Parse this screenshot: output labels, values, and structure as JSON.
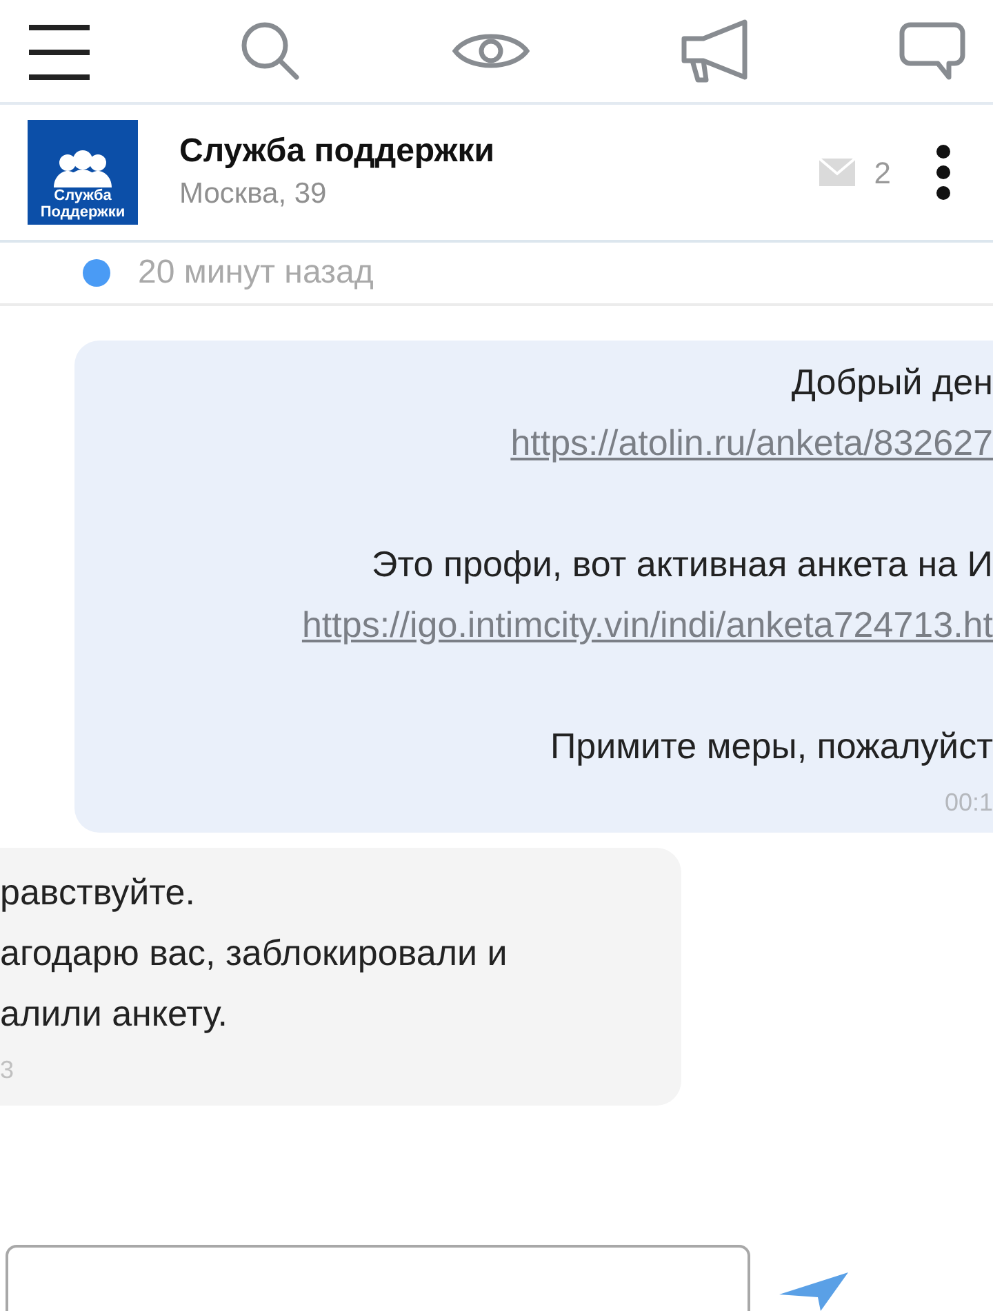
{
  "header": {
    "title": "Служба поддержки",
    "subtitle": "Москва, 39",
    "logo_text": [
      "Служба",
      "Поддержки"
    ],
    "message_count": "2"
  },
  "status": {
    "online": true,
    "last_seen": "20 минут назад"
  },
  "messages": [
    {
      "kind": "outgoing",
      "lines": [
        {
          "kind": "text",
          "text": "Добрый ден"
        },
        {
          "kind": "link",
          "text": "https://atolin.ru/anketa/832627"
        },
        {
          "kind": "blank"
        },
        {
          "kind": "text",
          "text": "Это профи, вот активная анкета на И"
        },
        {
          "kind": "link",
          "text": "https://igo.intimcity.vin/indi/anketa724713.ht"
        },
        {
          "kind": "blank"
        },
        {
          "kind": "text",
          "text": "Примите меры, пожалуйст"
        }
      ],
      "time": "00:1"
    },
    {
      "kind": "incoming",
      "lines": [
        {
          "kind": "text",
          "text": "равствуйте."
        },
        {
          "kind": "text",
          "text": "агодарю вас, заблокировали и"
        },
        {
          "kind": "text",
          "text": "алили анкету."
        }
      ],
      "time": "3"
    }
  ]
}
